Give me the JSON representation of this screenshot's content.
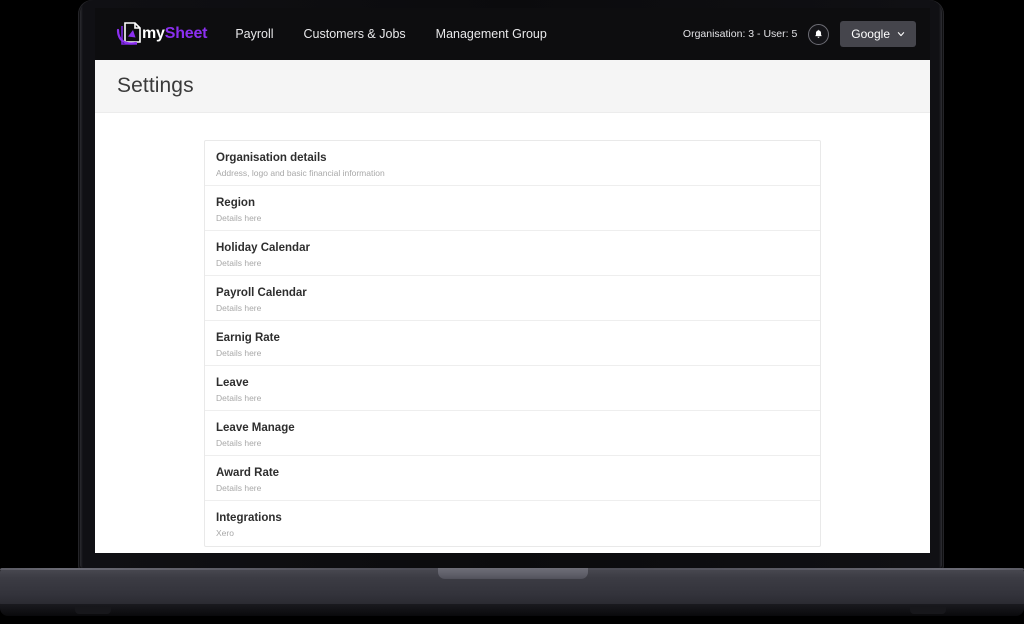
{
  "header": {
    "brand": {
      "icon": "document-swoosh-logo",
      "text_primary": "my",
      "text_accent": "Sheet",
      "accent_color": "#8b2ff0"
    },
    "nav": [
      {
        "label": "Payroll"
      },
      {
        "label": "Customers & Jobs"
      },
      {
        "label": "Management Group"
      }
    ],
    "org_user_status": "Organisation: 3 - User: 5",
    "notifications_icon": "bell-icon",
    "account": {
      "label": "Google",
      "chevron_icon": "chevron-down-icon"
    }
  },
  "page": {
    "title": "Settings"
  },
  "settings": {
    "items": [
      {
        "title": "Organisation details",
        "subtitle": "Address, logo and basic financial information"
      },
      {
        "title": "Region",
        "subtitle": "Details here"
      },
      {
        "title": "Holiday Calendar",
        "subtitle": "Details here"
      },
      {
        "title": "Payroll Calendar",
        "subtitle": "Details here"
      },
      {
        "title": "Earnig Rate",
        "subtitle": "Details here"
      },
      {
        "title": "Leave",
        "subtitle": "Details here"
      },
      {
        "title": "Leave Manage",
        "subtitle": "Details here"
      },
      {
        "title": "Award Rate",
        "subtitle": "Details here"
      },
      {
        "title": "Integrations",
        "subtitle": "Xero"
      }
    ]
  }
}
